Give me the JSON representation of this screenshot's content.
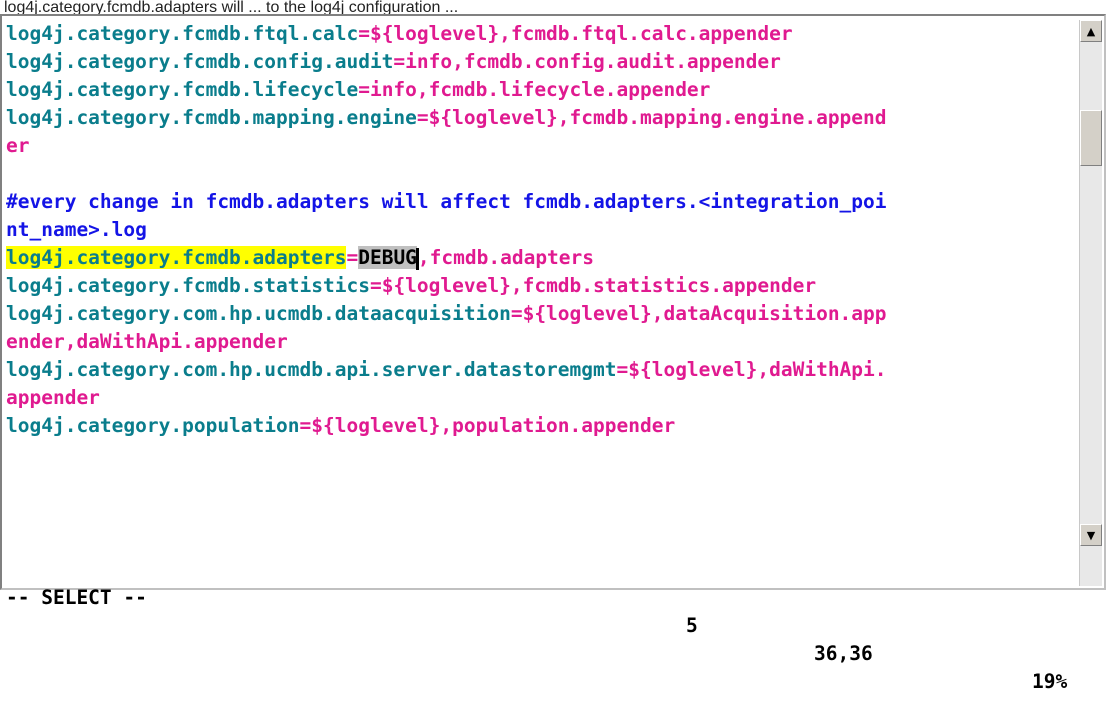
{
  "caption": "log4j.category.fcmdb.adapters will ... to the log4j configuration ... ",
  "lines": [
    {
      "parts": [
        [
          "k",
          "log4j.category.fcmdb.ftql.calc"
        ],
        [
          "e",
          "="
        ],
        [
          "v",
          "${loglevel},fcmdb.ftql.calc.appender"
        ]
      ]
    },
    {
      "parts": [
        [
          "k",
          "log4j.category.fcmdb.config.audit"
        ],
        [
          "e",
          "="
        ],
        [
          "v",
          "info,fcmdb.config.audit.appender"
        ]
      ]
    },
    {
      "parts": [
        [
          "k",
          "log4j.category.fcmdb.lifecycle"
        ],
        [
          "e",
          "="
        ],
        [
          "v",
          "info,fcmdb.lifecycle.appender"
        ]
      ]
    },
    {
      "parts": [
        [
          "k",
          "log4j.category.fcmdb.mapping.engine"
        ],
        [
          "e",
          "="
        ],
        [
          "v",
          "${loglevel},fcmdb.mapping.engine.append"
        ]
      ]
    },
    {
      "parts": [
        [
          "v",
          "er"
        ]
      ]
    },
    {
      "parts": []
    },
    {
      "parts": [
        [
          "c",
          "#every change in fcmdb.adapters will affect fcmdb.adapters.<integration_poi"
        ]
      ]
    },
    {
      "parts": [
        [
          "c",
          "nt_name>.log"
        ]
      ]
    },
    {
      "parts": [
        [
          "h",
          "log4j.category.fcmdb.adapters"
        ],
        [
          "e",
          "="
        ],
        [
          "s",
          "DEBUG"
        ],
        [
          "cur",
          ""
        ],
        [
          "v",
          ",fcmdb.adapters"
        ]
      ]
    },
    {
      "parts": [
        [
          "k",
          "log4j.category.fcmdb.statistics"
        ],
        [
          "e",
          "="
        ],
        [
          "v",
          "${loglevel},fcmdb.statistics.appender"
        ]
      ]
    },
    {
      "parts": [
        [
          "k",
          "log4j.category.com.hp.ucmdb.dataacquisition"
        ],
        [
          "e",
          "="
        ],
        [
          "v",
          "${loglevel},dataAcquisition.app"
        ]
      ]
    },
    {
      "parts": [
        [
          "v",
          "ender,daWithApi.appender"
        ]
      ]
    },
    {
      "parts": [
        [
          "k",
          "log4j.category.com.hp.ucmdb.api.server.datastoremgmt"
        ],
        [
          "e",
          "="
        ],
        [
          "v",
          "${loglevel},daWithApi."
        ]
      ]
    },
    {
      "parts": [
        [
          "v",
          "appender"
        ]
      ]
    },
    {
      "parts": [
        [
          "k",
          "log4j.category.population"
        ],
        [
          "e",
          "="
        ],
        [
          "v",
          "${loglevel},population.appender"
        ]
      ]
    }
  ],
  "status": {
    "mode": "-- SELECT --",
    "count": "5",
    "position": "36,36",
    "percent": "19%"
  },
  "scrollbar": {
    "up_icon": "arrow-up-icon",
    "down_icon": "arrow-down-icon",
    "up_glyph": "▲",
    "down_glyph": "▼"
  },
  "colors": {
    "key": "#0a7d8c",
    "value": "#e01a90",
    "comment": "#1414e6",
    "highlight": "#ffff00",
    "selection": "#c0c0c0"
  }
}
